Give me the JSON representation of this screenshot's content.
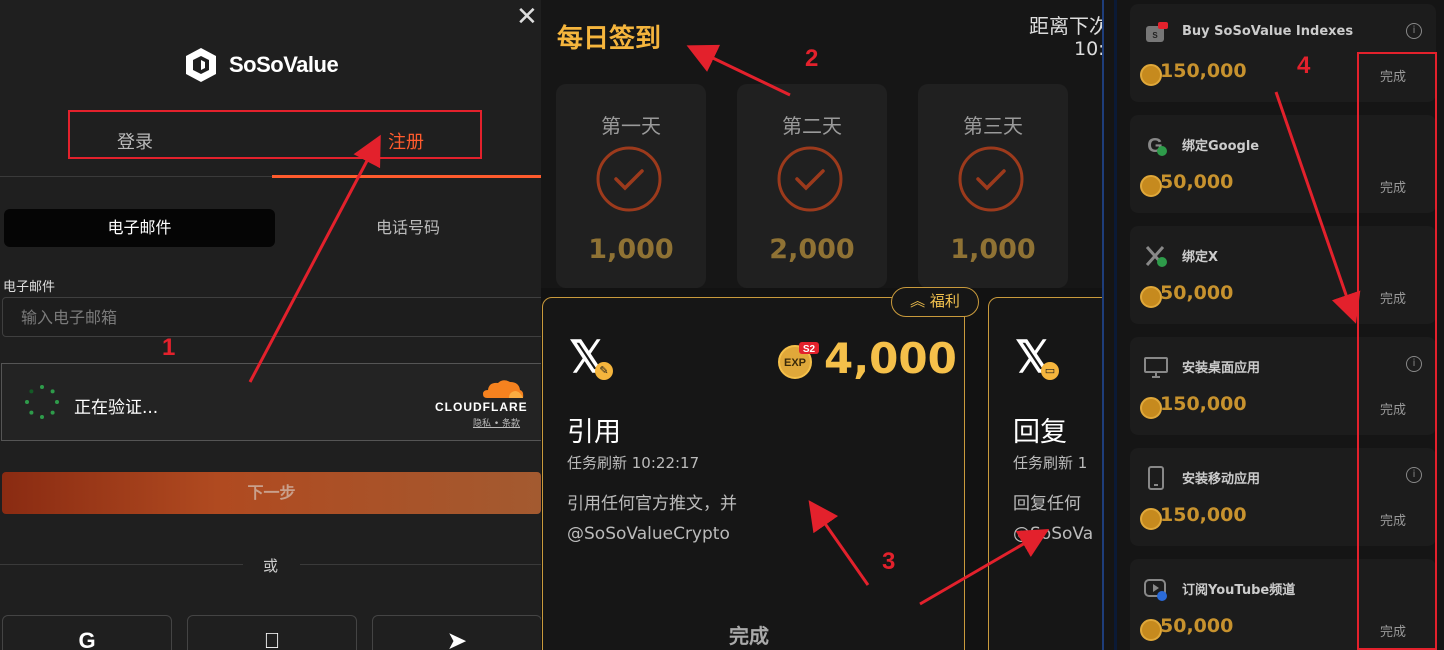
{
  "login_panel": {
    "brand": "SoSoValue",
    "tabs": {
      "login": "登录",
      "register": "注册"
    },
    "segment": {
      "email": "电子邮件",
      "phone": "电话号码"
    },
    "email_label": "电子邮件",
    "email_placeholder": "输入电子邮箱",
    "captcha": {
      "status": "正在验证...",
      "brand": "CLOUDFLARE",
      "links": "隐私 • 条款"
    },
    "next_button": "下一步",
    "or_label": "或",
    "social_icons": [
      "google-icon",
      "apple-icon",
      "telegram-icon"
    ]
  },
  "checkin_panel": {
    "title": "每日签到",
    "countdown_label": "距离下次",
    "countdown_time": "10:",
    "days": [
      {
        "name": "第一天",
        "points": "1,000"
      },
      {
        "name": "第二天",
        "points": "2,000"
      },
      {
        "name": "第三天",
        "points": "1,000"
      }
    ],
    "badge": "福利",
    "exp_label": "EXP",
    "exp_season": "S2",
    "tasks": [
      {
        "title": "引用",
        "refresh": "任务刷新 10:22:17",
        "desc1": "引用任何官方推文，并",
        "desc2": "@SoSoValueCrypto",
        "points": "4,000",
        "done": "完成"
      },
      {
        "title": "回复",
        "refresh": "任务刷新 1",
        "desc1": "回复任何",
        "desc2": "@SoSoVa"
      }
    ]
  },
  "tasks_panel": {
    "items": [
      {
        "name": "Buy SoSoValue Indexes",
        "points": "150,000",
        "done": "完成",
        "icon": "sosovalue-icon",
        "info": true
      },
      {
        "name": "绑定Google",
        "points": "50,000",
        "done": "完成",
        "icon": "google-icon",
        "info": false
      },
      {
        "name": "绑定X",
        "points": "50,000",
        "done": "完成",
        "icon": "x-icon",
        "info": false
      },
      {
        "name": "安装桌面应用",
        "points": "150,000",
        "done": "完成",
        "icon": "desktop-icon",
        "info": true
      },
      {
        "name": "安装移动应用",
        "points": "150,000",
        "done": "完成",
        "icon": "mobile-icon",
        "info": true
      },
      {
        "name": "订阅YouTube频道",
        "points": "50,000",
        "done": "完成",
        "icon": "youtube-icon",
        "info": false
      }
    ]
  },
  "annotations": {
    "labels": [
      "1",
      "2",
      "3",
      "4"
    ],
    "color": "#e3212c"
  },
  "colors": {
    "accent_orange": "#ff5b2d",
    "gold": "#f5b53d",
    "annotation_red": "#e3212c"
  }
}
